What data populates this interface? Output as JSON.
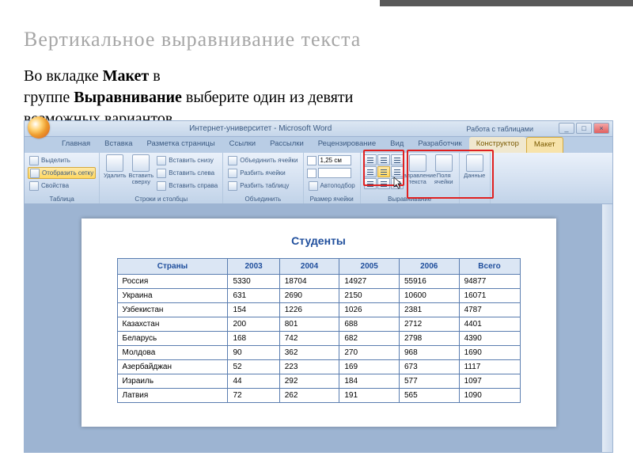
{
  "slide": {
    "title": "Вертикальное выравнивание текста",
    "text_p1_a": "Во вкладке ",
    "text_p1_b": "Макет",
    "text_p1_c": " в",
    "text_p2_a": "группе ",
    "text_p2_b": "Выравнивание",
    "text_p2_c": " выберите один из девяти",
    "text_p3": "возможных вариантов"
  },
  "word": {
    "title": "Интернет-университет - Microsoft Word",
    "context": "Работа с таблицами",
    "tabs": [
      "Главная",
      "Вставка",
      "Разметка страницы",
      "Ссылки",
      "Рассылки",
      "Рецензирование",
      "Вид",
      "Разработчик",
      "Конструктор",
      "Макет"
    ],
    "ribbon": {
      "g1": {
        "label": "Таблица",
        "select": "Выделить",
        "grid": "Отобразить сетку",
        "props": "Свойства"
      },
      "g2": {
        "label": "Строки и столбцы",
        "delete": "Удалить",
        "insTop": "Вставить сверху",
        "insBot": "Вставить снизу",
        "insLeft": "Вставить слева",
        "insRight": "Вставить справа"
      },
      "g3": {
        "label": "Объединить",
        "merge": "Объединить ячейки",
        "split": "Разбить ячейки",
        "splitTbl": "Разбить таблицу"
      },
      "g4": {
        "label": "Размер ячейки",
        "h": "1,25 см",
        "w": "",
        "auto": "Автоподбор"
      },
      "g5": {
        "label": "Выравнивание",
        "dir": "Направление текста",
        "margins": "Поля ячейки"
      },
      "g6": {
        "label": "Данные"
      }
    }
  },
  "doc": {
    "title": "Студенты"
  },
  "chart_data": {
    "type": "table",
    "columns": [
      "Страны",
      "2003",
      "2004",
      "2005",
      "2006",
      "Всего"
    ],
    "rows": [
      [
        "Россия",
        "5330",
        "18704",
        "14927",
        "55916",
        "94877"
      ],
      [
        "Украина",
        "631",
        "2690",
        "2150",
        "10600",
        "16071"
      ],
      [
        "Узбекистан",
        "154",
        "1226",
        "1026",
        "2381",
        "4787"
      ],
      [
        "Казахстан",
        "200",
        "801",
        "688",
        "2712",
        "4401"
      ],
      [
        "Беларусь",
        "168",
        "742",
        "682",
        "2798",
        "4390"
      ],
      [
        "Молдова",
        "90",
        "362",
        "270",
        "968",
        "1690"
      ],
      [
        "Азербайджан",
        "52",
        "223",
        "169",
        "673",
        "1117"
      ],
      [
        "Израиль",
        "44",
        "292",
        "184",
        "577",
        "1097"
      ],
      [
        "Латвия",
        "72",
        "262",
        "191",
        "565",
        "1090"
      ]
    ]
  }
}
